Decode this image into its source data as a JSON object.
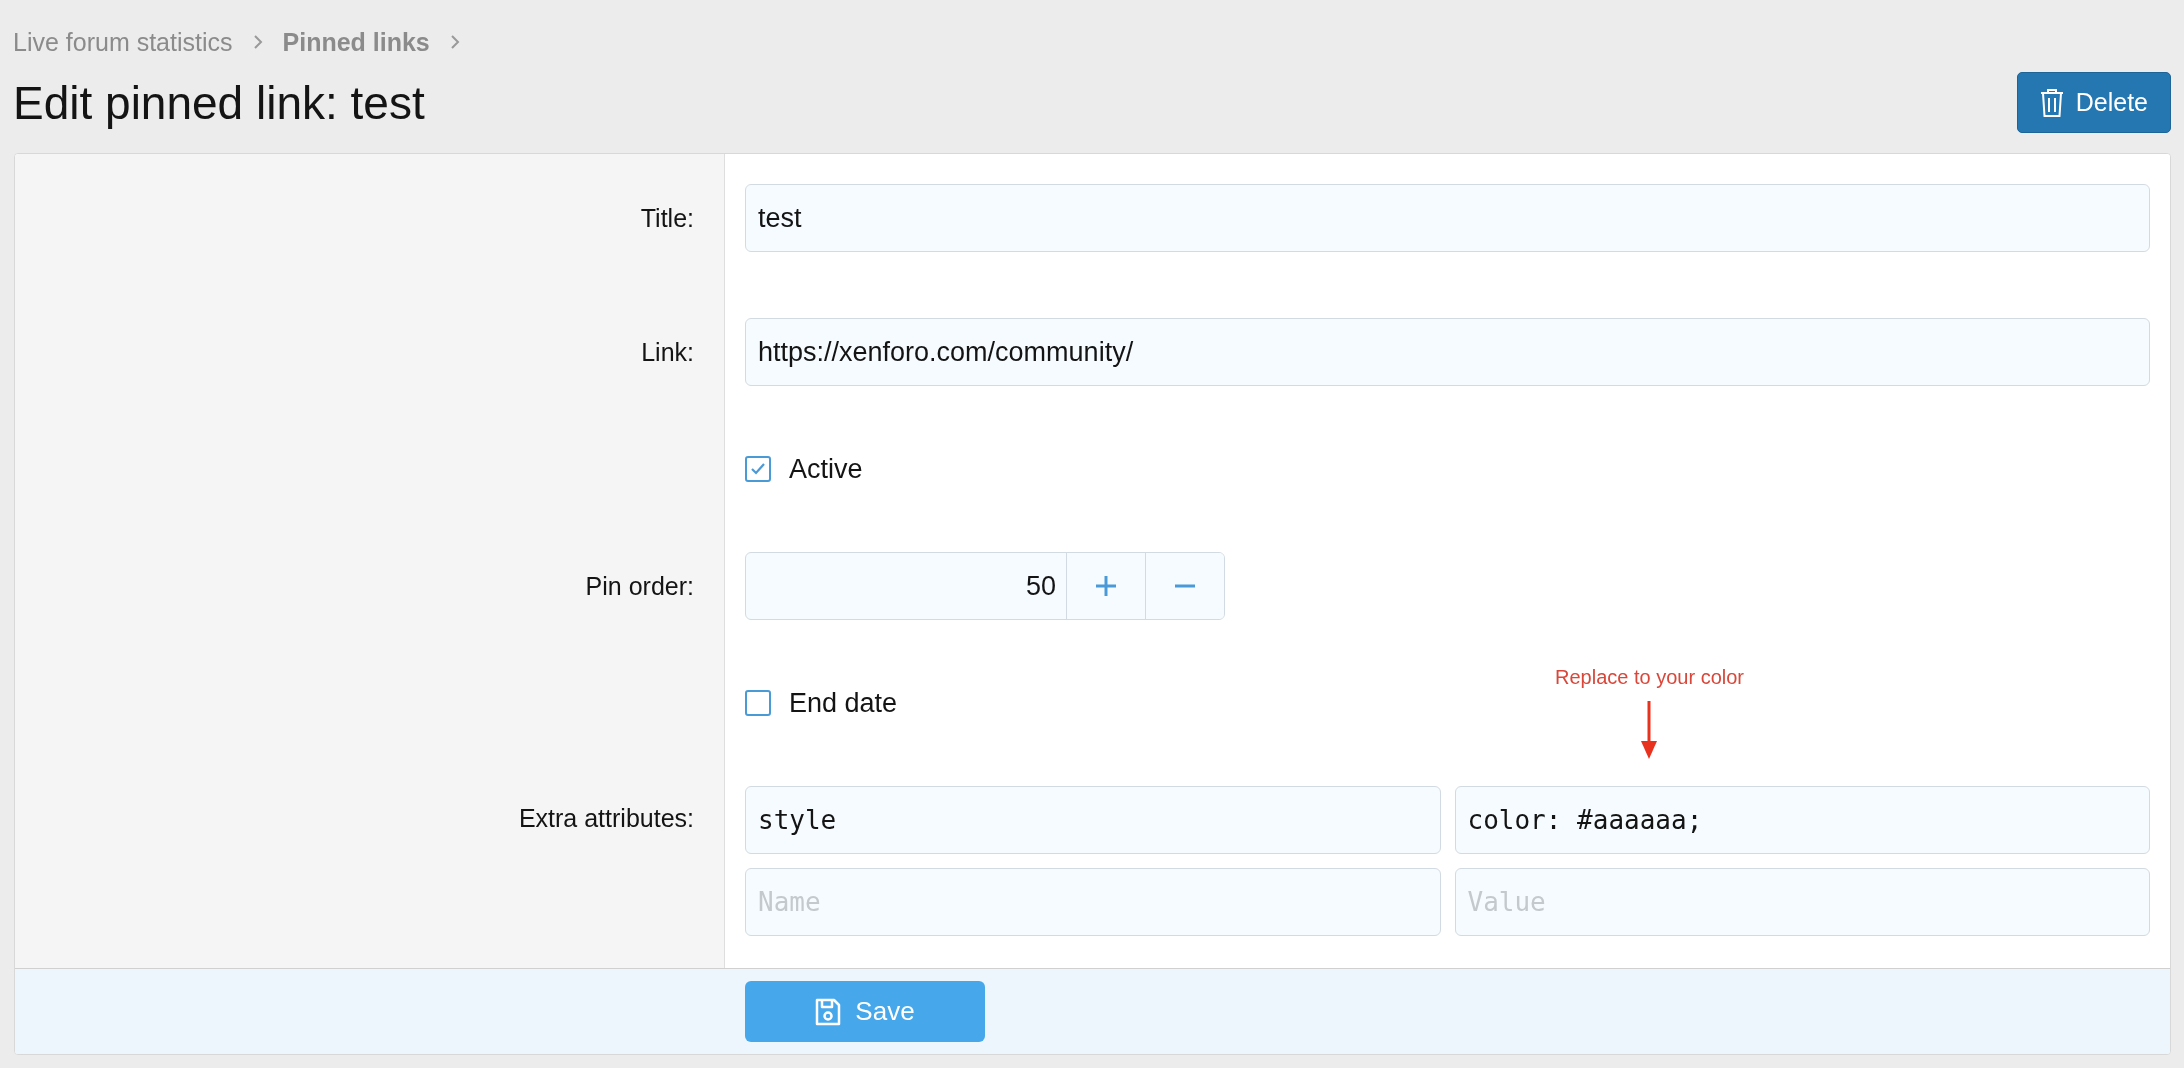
{
  "breadcrumb": [
    {
      "label": "Live forum statistics",
      "bold": false
    },
    {
      "label": "Pinned links",
      "bold": true
    }
  ],
  "page_title": "Edit pinned link: test",
  "delete_button": "Delete",
  "form": {
    "rows": [
      {
        "kind": "text",
        "label": "Title:",
        "value": "test"
      },
      {
        "kind": "text",
        "label": "Link:",
        "value": "https://xenforo.com/community/"
      },
      {
        "kind": "checkbox",
        "label": "Active",
        "checked": true
      },
      {
        "kind": "spinner",
        "label": "Pin order:",
        "value": "50"
      },
      {
        "kind": "checkbox",
        "label": "End date",
        "checked": false
      },
      {
        "kind": "pairs",
        "label": "Extra attributes:",
        "annotation": "Replace to your color",
        "pairs": [
          {
            "name": {
              "value": "style"
            },
            "value": {
              "value": "color: #aaaaaa;"
            }
          },
          {
            "name": {
              "placeholder": "Name"
            },
            "value": {
              "placeholder": "Value"
            }
          }
        ]
      }
    ]
  },
  "save_button": "Save"
}
